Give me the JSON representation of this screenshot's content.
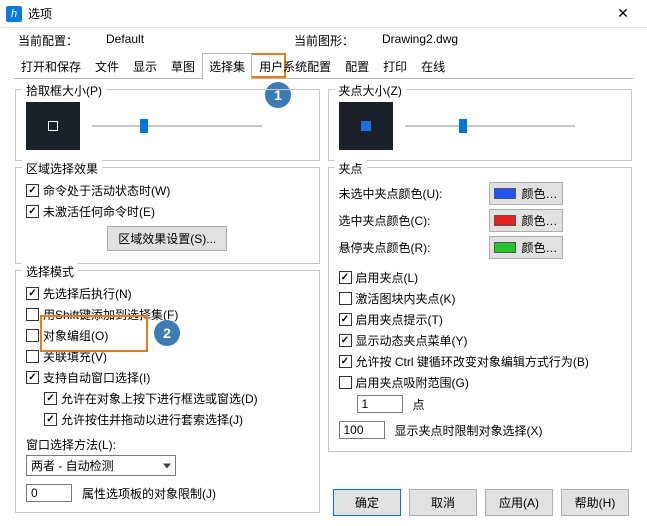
{
  "window": {
    "icon_letter": "h",
    "title": "选项"
  },
  "config": {
    "current_config_label": "当前配置：",
    "current_config_value": "Default",
    "current_drawing_label": "当前图形：",
    "current_drawing_value": "Drawing2.dwg"
  },
  "tabs": [
    "打开和保存",
    "文件",
    "显示",
    "草图",
    "选择集",
    "用户系统配置",
    "配置",
    "打印",
    "在线"
  ],
  "active_tab_index": 4,
  "markers": {
    "one": "1",
    "two": "2"
  },
  "left": {
    "pickbox": {
      "legend": "拾取框大小(P)",
      "slider_pos_pct": 28
    },
    "area_effect": {
      "legend": "区域选择效果",
      "opt_active": "命令处于活动状态时(W)",
      "opt_inactive": "未激活任何命令时(E)",
      "settings_btn": "区域效果设置(S)..."
    },
    "select_mode": {
      "legend": "选择模式",
      "opt_post_select": "先选择后执行(N)",
      "opt_shift_add": "用Shift键添加到选择集(F)",
      "opt_obj_group": "对象编组(O)",
      "opt_assoc_hatch": "关联填充(V)",
      "opt_auto_window": "支持自动窗口选择(I)",
      "opt_allow_window_lasso": "允许在对象上按下进行框选或窗选(D)",
      "opt_allow_hold_drag": "允许按住并拖动以进行套索选择(J)",
      "window_method_label": "窗口选择方法(L):",
      "window_method_value": "两者 - 自动检测",
      "prop_limit_value": "0",
      "prop_limit_label": "属性选项板的对象限制(J)"
    }
  },
  "right": {
    "gripsize": {
      "legend": "夹点大小(Z)",
      "slider_pos_pct": 32
    },
    "grips": {
      "legend": "夹点",
      "color_unsel_label": "未选中夹点颜色(U):",
      "color_sel_label": "选中夹点颜色(C):",
      "color_hover_label": "悬停夹点颜色(R):",
      "color_btn_text": "颜色…",
      "swatch_unsel": "#2454f3",
      "swatch_sel": "#e52020",
      "swatch_hover": "#22c728",
      "opt_enable": "启用夹点(L)",
      "opt_enable_block_inner": "激活图块内夹点(K)",
      "opt_enable_tips": "启用夹点提示(T)",
      "opt_dyn_menu": "显示动态夹点菜单(Y)",
      "opt_ctrl_cycle": "允许按 Ctrl 键循环改变对象编辑方式行为(B)",
      "opt_snap_range": "启用夹点吸附范围(G)",
      "snap_val": "1",
      "snap_unit": "点",
      "limit_val": "100",
      "limit_label": "显示夹点时限制对象选择(X)"
    }
  },
  "footer": {
    "ok": "确定",
    "cancel": "取消",
    "apply": "应用(A)",
    "help": "帮助(H)"
  }
}
